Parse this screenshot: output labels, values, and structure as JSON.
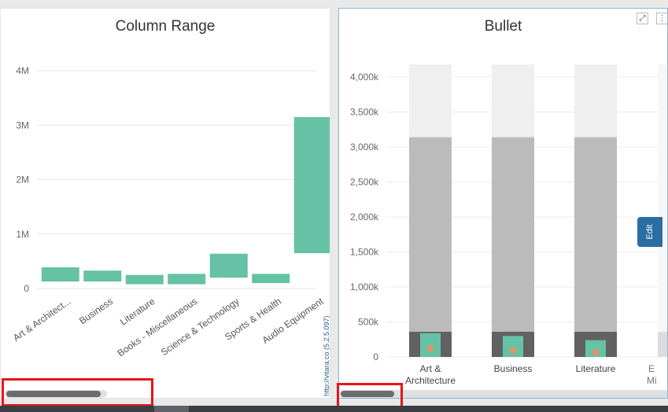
{
  "colors": {
    "accent_green": "#66c2a4",
    "range_light": "#efefef",
    "range_mid": "#bbbbbb",
    "range_dark": "#616161",
    "target_marker": "#f28c64",
    "highlight_red": "#e8141b",
    "edit_tab": "#2a6ea3"
  },
  "right_panel": {
    "expand_icon": "expand-icon",
    "menu_icon": "menu-icon",
    "edit_label": "Edit"
  },
  "scrollbars": {
    "left_progress": 0.28,
    "right_progress": 0.17
  },
  "chart_data": [
    {
      "type": "bar",
      "subtype": "column-range",
      "title": "Column Range",
      "categories": [
        "Art & Architect...",
        "Business",
        "Literature",
        "Books - Miscellaneous",
        "Science & Technology",
        "Sports & Health",
        "Audio Equipment"
      ],
      "ranges": [
        [
          130000,
          390000
        ],
        [
          130000,
          330000
        ],
        [
          80000,
          250000
        ],
        [
          80000,
          270000
        ],
        [
          200000,
          640000
        ],
        [
          100000,
          270000
        ],
        [
          650000,
          3150000
        ]
      ],
      "ylim": [
        0,
        4000000
      ],
      "yticks": [
        {
          "v": 0,
          "label": "0"
        },
        {
          "v": 1000000,
          "label": "1M"
        },
        {
          "v": 2000000,
          "label": "2M"
        },
        {
          "v": 3000000,
          "label": "3M"
        },
        {
          "v": 4000000,
          "label": "4M"
        }
      ],
      "grid": true,
      "credit": "http://vitara.co (5.2.5.097)"
    },
    {
      "type": "bar",
      "subtype": "bullet",
      "title": "Bullet",
      "categories": [
        "Art &\nArchitecture",
        "Business",
        "Literature"
      ],
      "bands": [
        {
          "name": "light",
          "values": [
            4180000,
            4180000,
            4180000
          ]
        },
        {
          "name": "mid",
          "values": [
            3140000,
            3140000,
            3140000
          ]
        },
        {
          "name": "dark",
          "values": [
            360000,
            360000,
            360000
          ]
        }
      ],
      "values": [
        340000,
        300000,
        240000
      ],
      "targets": [
        120000,
        90000,
        65000
      ],
      "ylim": [
        0,
        4000000
      ],
      "yticks": [
        {
          "v": 0,
          "label": "0"
        },
        {
          "v": 500000,
          "label": "500k"
        },
        {
          "v": 1000000,
          "label": "1,000k"
        },
        {
          "v": 1500000,
          "label": "1,500k"
        },
        {
          "v": 2000000,
          "label": "2,000k"
        },
        {
          "v": 2500000,
          "label": "2,500k"
        },
        {
          "v": 3000000,
          "label": "3,000k"
        },
        {
          "v": 3500000,
          "label": "3,500k"
        },
        {
          "v": 4000000,
          "label": "4,000k"
        }
      ],
      "grid": true,
      "partial_next_label": "E\nMi"
    }
  ]
}
